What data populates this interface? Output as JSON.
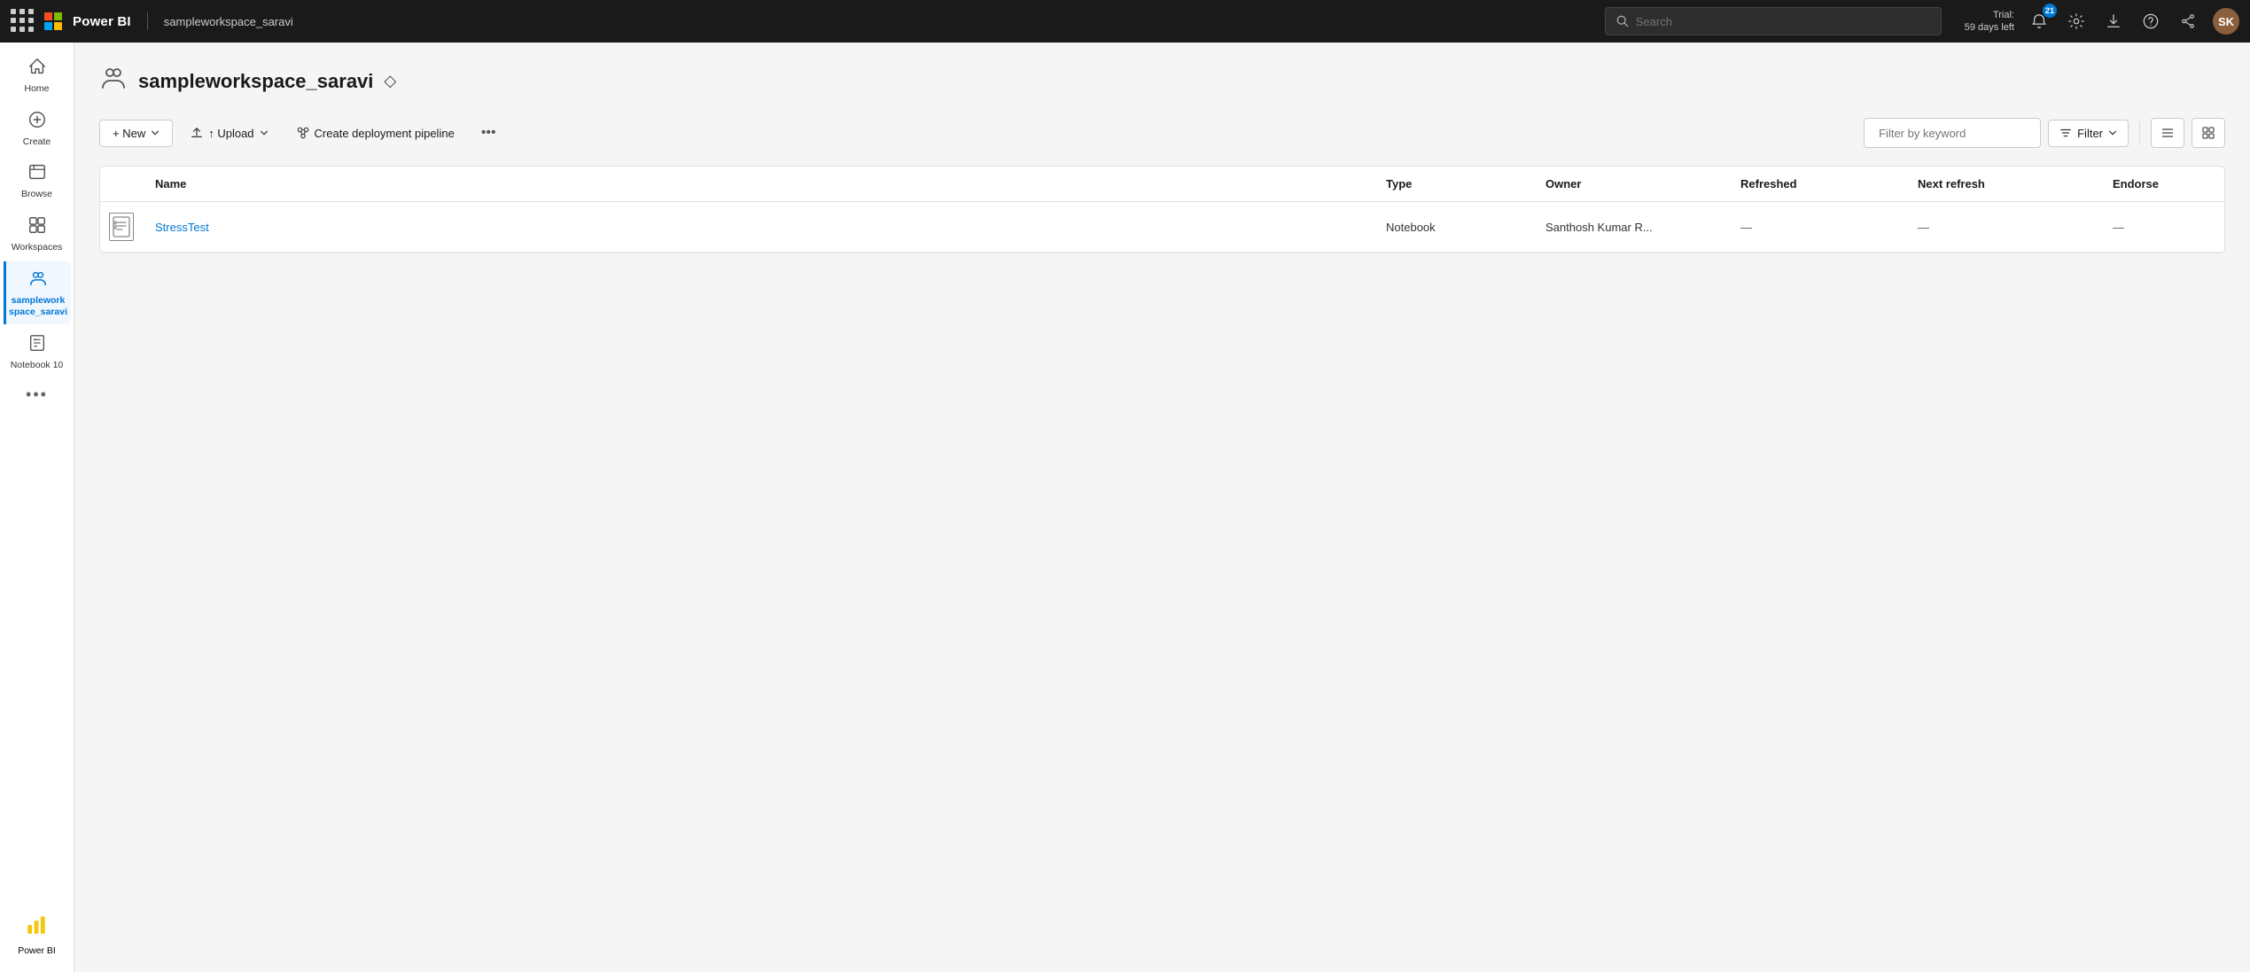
{
  "topnav": {
    "brand": "Power BI",
    "workspace_label": "sampleworkspace_saravi",
    "search_placeholder": "Search",
    "trial_line1": "Trial:",
    "trial_line2": "59 days left",
    "notif_count": "21",
    "avatar_initials": "SK"
  },
  "sidebar": {
    "items": [
      {
        "id": "home",
        "label": "Home",
        "icon": "⌂"
      },
      {
        "id": "create",
        "label": "Create",
        "icon": "+"
      },
      {
        "id": "browse",
        "label": "Browse",
        "icon": "❑"
      },
      {
        "id": "workspaces",
        "label": "Workspaces",
        "icon": "⊡"
      },
      {
        "id": "sampleworkspace",
        "label": "samplework space_saravi",
        "icon": "👥",
        "active": true
      },
      {
        "id": "notebook10",
        "label": "Notebook 10",
        "icon": "</>"
      }
    ],
    "more_label": "•••",
    "powerbi_label": "Power BI"
  },
  "workspace": {
    "title": "sampleworkspace_saravi",
    "icon_label": "workspace-icon",
    "diamond_label": "◇"
  },
  "toolbar": {
    "new_label": "+ New",
    "upload_label": "↑ Upload",
    "pipeline_label": "Create deployment pipeline",
    "more_label": "•••",
    "filter_placeholder": "Filter by keyword",
    "filter_label": "Filter",
    "view_icon": "≡",
    "view2_icon": "⊞"
  },
  "table": {
    "columns": [
      {
        "id": "icon",
        "label": ""
      },
      {
        "id": "name",
        "label": "Name"
      },
      {
        "id": "type",
        "label": "Type"
      },
      {
        "id": "owner",
        "label": "Owner"
      },
      {
        "id": "refreshed",
        "label": "Refreshed"
      },
      {
        "id": "next_refresh",
        "label": "Next refresh"
      },
      {
        "id": "endorse",
        "label": "Endorse"
      }
    ],
    "rows": [
      {
        "icon": "notebook",
        "name": "StressTest",
        "type": "Notebook",
        "owner": "Santhosh Kumar R...",
        "refreshed": "—",
        "next_refresh": "—",
        "endorse": "—"
      }
    ]
  }
}
